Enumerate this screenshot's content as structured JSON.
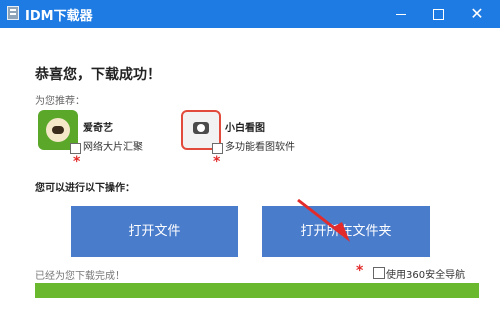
{
  "window": {
    "title": "IDM下载器",
    "minimize_label": "",
    "maximize_label": "",
    "close_label": "✕"
  },
  "content": {
    "headline": "恭喜您，下载成功！",
    "recommend_label": "为您推荐：",
    "apps": [
      {
        "name": "爱奇艺",
        "desc": "网络大片汇聚",
        "icon": "iqiyi-icon"
      },
      {
        "name": "小白看图",
        "desc": "多功能看图软件",
        "icon": "photo-viewer-icon"
      }
    ],
    "ops_label": "您可以进行以下操作：",
    "buttons": {
      "open_file": "打开文件",
      "open_folder": "打开所在文件夹"
    },
    "status_text": "已经为您下载完成！",
    "nav_checkbox_label": "使用360安全导航",
    "progress": 1.0
  },
  "colors": {
    "titlebar": "#1e7be3",
    "button": "#4a7ccc",
    "progress": "#6ab82e",
    "star": "#e32b2b"
  }
}
